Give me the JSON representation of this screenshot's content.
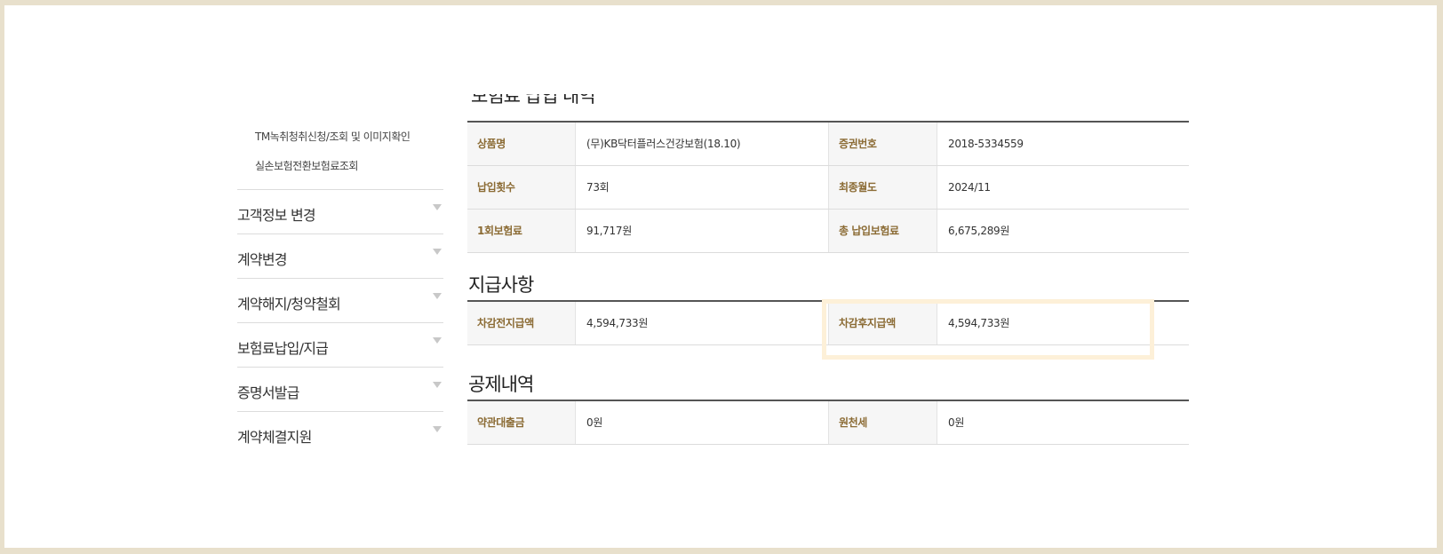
{
  "sidebar": {
    "sub_links": [
      "TM녹취청취신청/조회 및 이미지확인",
      "실손보험전환보험료조회"
    ],
    "menu": [
      {
        "label": "고객정보 변경"
      },
      {
        "label": "계약변경"
      },
      {
        "label": "계약해지/청약철회"
      },
      {
        "label": "보험료납입/지급"
      },
      {
        "label": "증명서발급"
      },
      {
        "label": "계약체결지원"
      }
    ]
  },
  "sections": {
    "contract": {
      "title_partial": "보험료 납입 내역",
      "rows": [
        {
          "k1": "상품명",
          "v1": "(무)KB닥터플러스건강보험(18.10)",
          "k2": "증권번호",
          "v2": "2018-5334559"
        },
        {
          "k1": "납입횟수",
          "v1": "73회",
          "k2": "최종월도",
          "v2": "2024/11"
        },
        {
          "k1": "1회보험료",
          "v1": "91,717원",
          "k2": "총 납입보험료",
          "v2": "6,675,289원"
        }
      ]
    },
    "payment": {
      "title": "지급사항",
      "rows": [
        {
          "k1": "차감전지급액",
          "v1": "4,594,733원",
          "k2": "차감후지급액",
          "v2": "4,594,733원"
        }
      ]
    },
    "deduction": {
      "title": "공제내역",
      "rows": [
        {
          "k1": "약관대출금",
          "v1": "0원",
          "k2": "원천세",
          "v2": "0원"
        }
      ]
    }
  },
  "colors": {
    "header_text": "#8b6b34",
    "highlight_border": "#fdf0d8",
    "frame_background": "#e8e0cc"
  }
}
